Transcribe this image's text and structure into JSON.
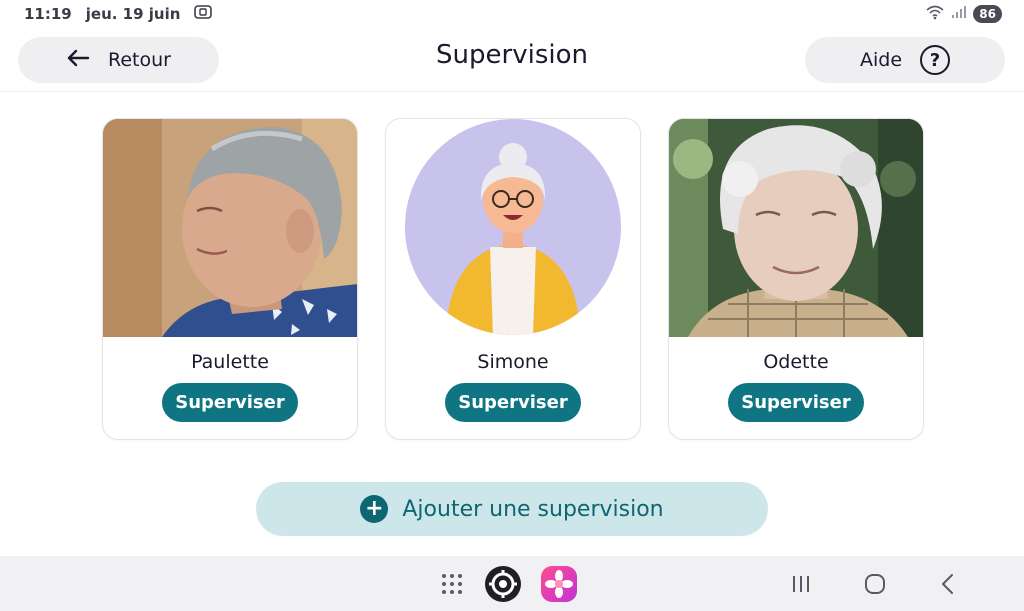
{
  "status": {
    "time": "11:19",
    "date": "jeu. 19 juin",
    "battery": "86"
  },
  "header": {
    "back_label": "Retour",
    "title": "Supervision",
    "help_label": "Aide",
    "help_symbol": "?"
  },
  "people": [
    {
      "name": "Paulette",
      "button": "Superviser"
    },
    {
      "name": "Simone",
      "button": "Superviser"
    },
    {
      "name": "Odette",
      "button": "Superviser"
    }
  ],
  "add_button": {
    "label": "Ajouter une supervision",
    "symbol": "+"
  },
  "colors": {
    "accent": "#0f7583",
    "add_button_bg": "#cde6ea",
    "pill_bg": "#efeff2"
  },
  "nav": {
    "icons": [
      "app-drawer-icon",
      "settings-app-icon",
      "gallery-app-icon",
      "recents-icon",
      "home-icon",
      "back-icon"
    ]
  }
}
